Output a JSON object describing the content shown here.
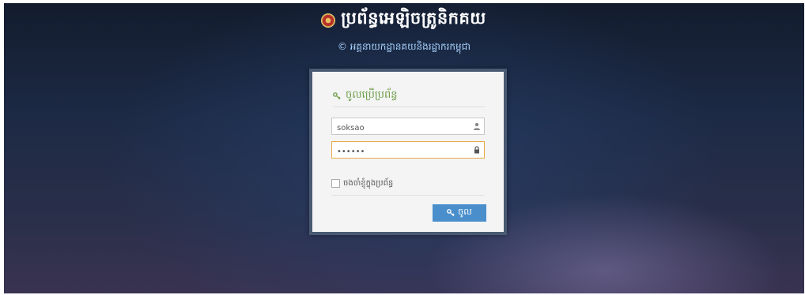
{
  "header": {
    "title": "ប្រព័ន្ធអេឡិចត្រូនិកគយ",
    "subtitle": "© អគ្គនាយកដ្ឋានគយនិងរដ្ឋាករកម្ពុជា"
  },
  "login": {
    "heading": "ចូលប្រើប្រព័ន្ធ",
    "username_value": "soksao",
    "password_value": "••••••",
    "remember_label": "ចងចាំខ្ញុំក្នុងប្រព័ន្ធ",
    "submit_label": "ចូល"
  },
  "colors": {
    "accent_green": "#6e9e4a",
    "button_blue": "#4a8fcc",
    "focus_orange": "#e8a848",
    "subtitle_blue": "#a8d4ff"
  },
  "icons": {
    "seal": "emblem-seal-icon",
    "key": "key-icon",
    "user": "user-icon",
    "lock": "lock-icon"
  }
}
